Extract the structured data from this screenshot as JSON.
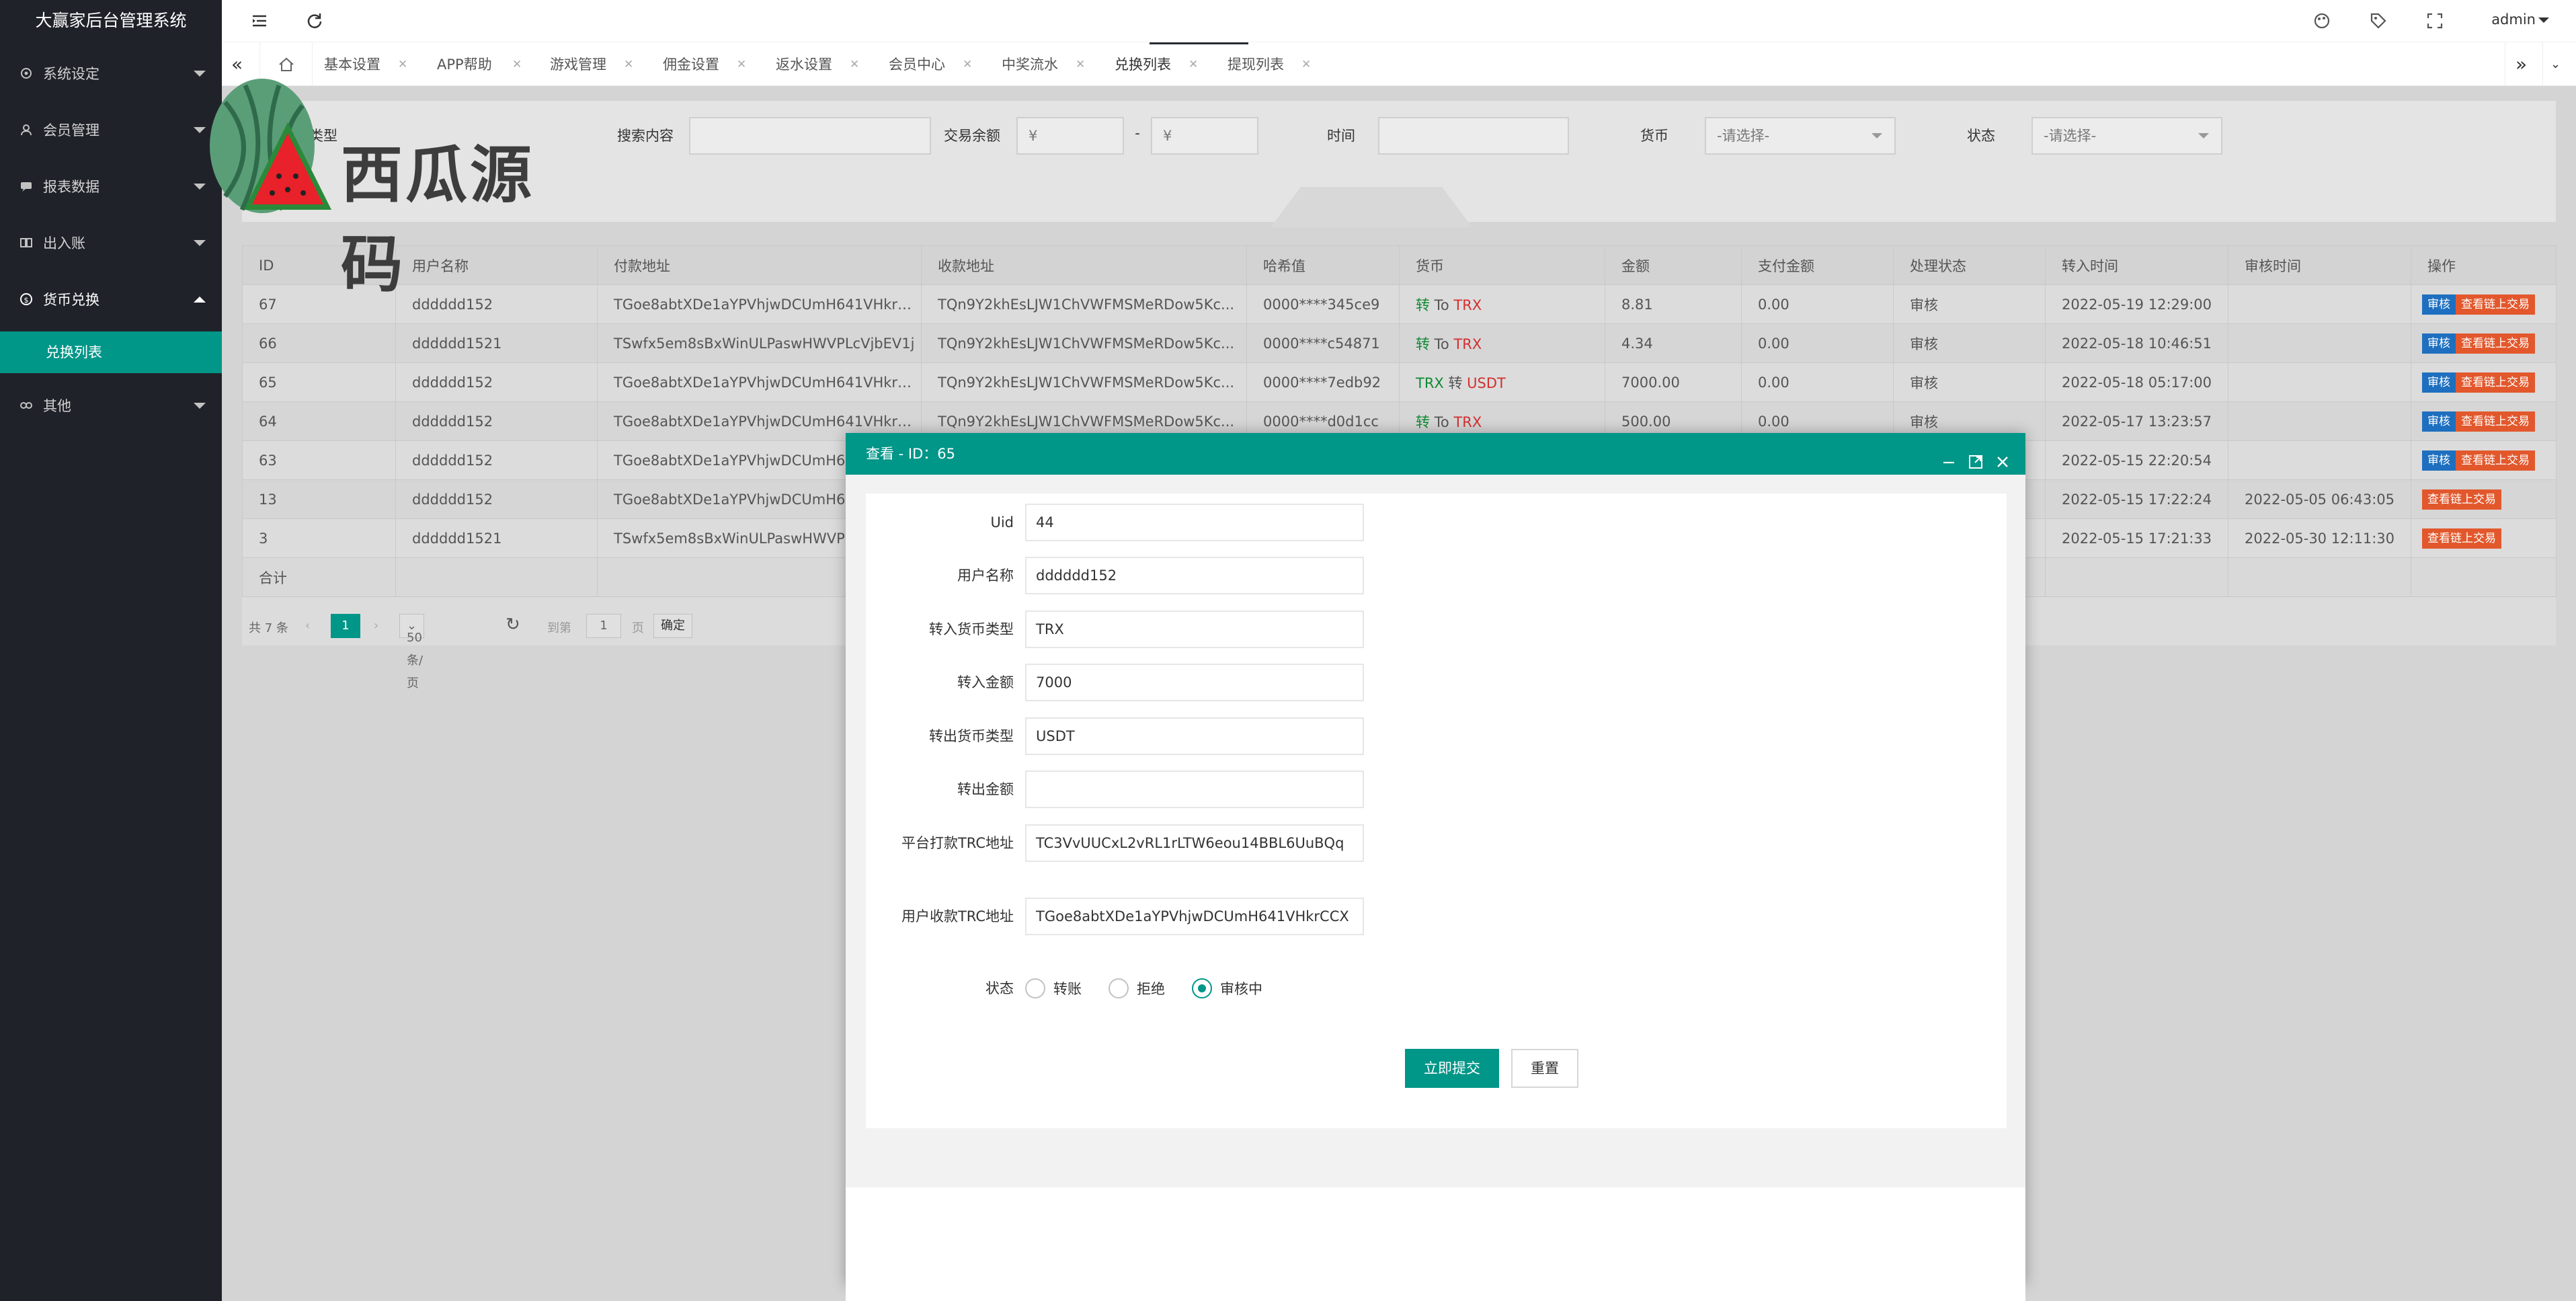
{
  "app": {
    "title": "大赢家后台管理系统",
    "user": "admin"
  },
  "sidebar": {
    "items": [
      {
        "label": "系统设定",
        "icon": "gear-icon"
      },
      {
        "label": "会员管理",
        "icon": "user-icon"
      },
      {
        "label": "报表数据",
        "icon": "chat-icon"
      },
      {
        "label": "出入账",
        "icon": "book-icon"
      },
      {
        "label": "货币兑换",
        "icon": "currency-icon"
      },
      {
        "label": "其他",
        "icon": "link-icon"
      }
    ],
    "sub_active": "兑换列表"
  },
  "tabs": [
    {
      "label": "基本设置"
    },
    {
      "label": "APP帮助"
    },
    {
      "label": "游戏管理"
    },
    {
      "label": "佣金设置"
    },
    {
      "label": "返水设置"
    },
    {
      "label": "会员中心"
    },
    {
      "label": "中奖流水"
    },
    {
      "label": "兑换列表",
      "active": true
    },
    {
      "label": "提现列表"
    }
  ],
  "search": {
    "search_type_label": "搜索类型",
    "content_label": "搜索内容",
    "amount_label": "交易余额",
    "amount_min_placeholder": "¥",
    "amount_sep": "-",
    "amount_max_placeholder": "¥",
    "time_label": "时间",
    "currency_label": "货币",
    "currency_value": "-请选择-",
    "status_label": "状态",
    "status_value": "-请选择-"
  },
  "watermark": {
    "text": "西瓜源码"
  },
  "table": {
    "columns": [
      "ID",
      "用户名称",
      "付款地址",
      "收款地址",
      "哈希值",
      "货币",
      "金额",
      "支付金额",
      "处理状态",
      "转入时间",
      "审核时间",
      "操作"
    ],
    "rows": [
      {
        "id": "67",
        "user": "dddddd152",
        "pay": "TGoe8abtXDe1aYPVhjwDCUmH641VHkrCCX",
        "recv": "TQn9Y2khEsLJW1ChVWFMSMeRDow5Kc...",
        "hash": "0000****345ce9",
        "cur_a": "转",
        "cur_mid": " To ",
        "cur_b": "TRX",
        "amount": "8.81",
        "paid": "0.00",
        "status": "审核",
        "in_time": "2022-05-19 12:29:00",
        "audit_time": "",
        "op_review": "审核",
        "op_chain": "查看链上交易"
      },
      {
        "id": "66",
        "user": "dddddd1521",
        "pay": "TSwfx5em8sBxWinULPaswHWVPLcVjbEV1j",
        "recv": "TQn9Y2khEsLJW1ChVWFMSMeRDow5Kc...",
        "hash": "0000****c54871",
        "cur_a": "转",
        "cur_mid": " To ",
        "cur_b": "TRX",
        "amount": "4.34",
        "paid": "0.00",
        "status": "审核",
        "in_time": "2022-05-18 10:46:51",
        "audit_time": "",
        "op_review": "审核",
        "op_chain": "查看链上交易"
      },
      {
        "id": "65",
        "user": "dddddd152",
        "pay": "TGoe8abtXDe1aYPVhjwDCUmH641VHkrCCX",
        "recv": "TQn9Y2khEsLJW1ChVWFMSMeRDow5Kc...",
        "hash": "0000****7edb92",
        "cur_a": "TRX",
        "cur_mid": " 转 ",
        "cur_b": "USDT",
        "amount": "7000.00",
        "paid": "0.00",
        "status": "审核",
        "in_time": "2022-05-18 05:17:00",
        "audit_time": "",
        "op_review": "审核",
        "op_chain": "查看链上交易"
      },
      {
        "id": "64",
        "user": "dddddd152",
        "pay": "TGoe8abtXDe1aYPVhjwDCUmH641VHkrCCX",
        "recv": "TQn9Y2khEsLJW1ChVWFMSMeRDow5Kc...",
        "hash": "0000****d0d1cc",
        "cur_a": "转",
        "cur_mid": " To ",
        "cur_b": "TRX",
        "amount": "500.00",
        "paid": "0.00",
        "status": "审核",
        "in_time": "2022-05-17 13:23:57",
        "audit_time": "",
        "op_review": "审核",
        "op_chain": "查看链上交易"
      },
      {
        "id": "63",
        "user": "dddddd152",
        "pay": "TGoe8abtXDe1aYPVhjwDCUmH641",
        "recv": "",
        "hash": "",
        "cur_a": "",
        "cur_mid": "",
        "cur_b": "",
        "amount": "",
        "paid": "",
        "status": "",
        "in_time": "2022-05-15 22:20:54",
        "audit_time": "",
        "op_review": "审核",
        "op_chain": "查看链上交易"
      },
      {
        "id": "13",
        "user": "dddddd152",
        "pay": "TGoe8abtXDe1aYPVhjwDCUmH641",
        "recv": "",
        "hash": "",
        "cur_a": "",
        "cur_mid": "",
        "cur_b": "",
        "amount": "",
        "paid": "",
        "status": "",
        "in_time": "2022-05-15 17:22:24",
        "audit_time": "2022-05-05 06:43:05",
        "op_review": "",
        "op_chain": "查看链上交易"
      },
      {
        "id": "3",
        "user": "dddddd1521",
        "pay": "TSwfx5em8sBxWinULPaswHWVPLc",
        "recv": "",
        "hash": "",
        "cur_a": "",
        "cur_mid": "",
        "cur_b": "",
        "amount": "",
        "paid": "",
        "status": "",
        "in_time": "2022-05-15 17:21:33",
        "audit_time": "2022-05-30 12:11:30",
        "op_review": "",
        "op_chain": "查看链上交易"
      }
    ],
    "sum_label": "合计"
  },
  "pager": {
    "total": "共 7 条",
    "current": "1",
    "per_page": "50 条/页",
    "goto": "到第",
    "goto_value": "1",
    "page": "页",
    "confirm": "确定"
  },
  "modal": {
    "title": "查看 - ID：65",
    "fields": [
      {
        "label": "Uid",
        "value": "44",
        "color": "#333333"
      },
      {
        "label": "用户名称",
        "value": "dddddd152",
        "color": "#333333"
      },
      {
        "label": "转入货币类型",
        "value": "TRX",
        "color": "#0f8a34"
      },
      {
        "label": "转入金额",
        "value": "7000",
        "color": "#0f8a34"
      },
      {
        "label": "转出货币类型",
        "value": "USDT",
        "color": "#d32f2f"
      },
      {
        "label": "转出金额",
        "value": "",
        "color": "#333333"
      },
      {
        "label": "平台打款TRC地址",
        "value": "TC3VvUUCxL2vRL1rLTW6eou14BBL6UuBQq",
        "color": "#333333"
      },
      {
        "label": "用户收款TRC地址",
        "value": "TGoe8abtXDe1aYPVhjwDCUmH641VHkrCCX",
        "color": "#333333"
      }
    ],
    "status_label": "状态",
    "status_options": [
      {
        "label": "转账",
        "checked": false
      },
      {
        "label": "拒绝",
        "checked": false
      },
      {
        "label": "审核中",
        "checked": true
      }
    ],
    "submit": "立即提交",
    "reset": "重置"
  },
  "colors": {
    "accent": "#009688",
    "sidebar": "#20222a",
    "green": "#0f8a34",
    "red": "#d32f2f",
    "blue": "#1e6fbf",
    "orange": "#e2582c"
  }
}
